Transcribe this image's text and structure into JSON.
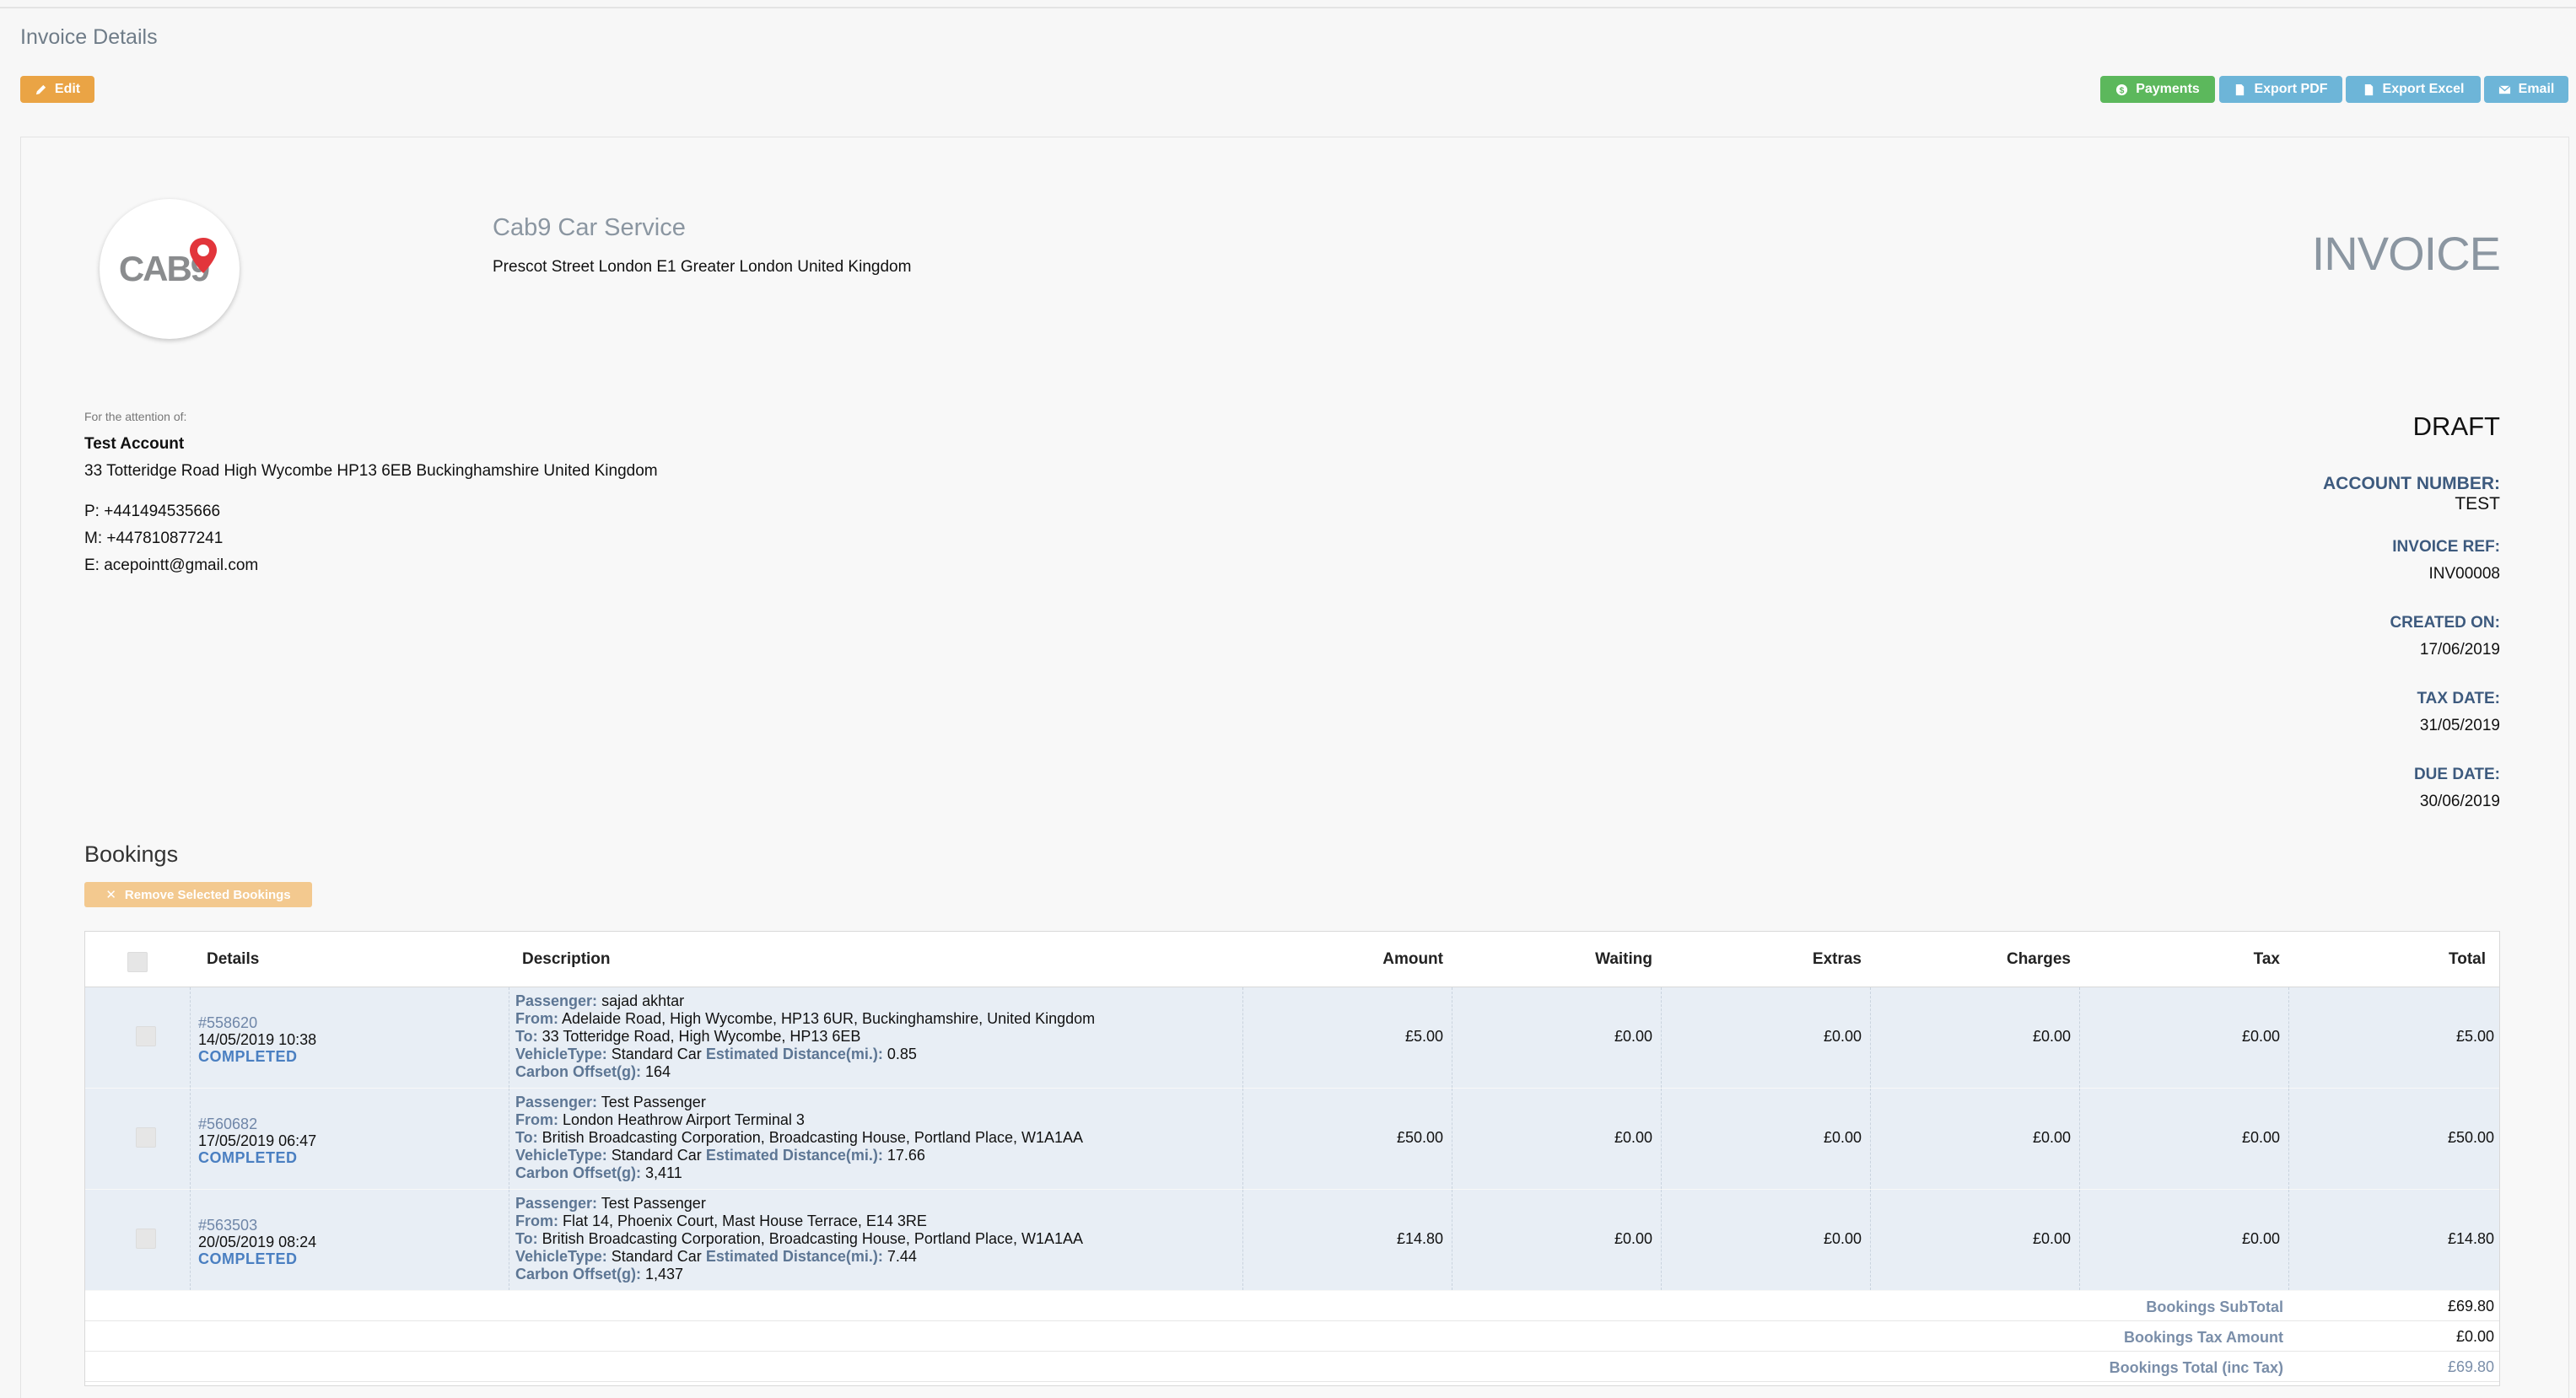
{
  "page": {
    "title": "Invoice Details"
  },
  "toolbar": {
    "edit_label": "Edit",
    "payments_label": "Payments",
    "export_pdf_label": "Export PDF",
    "export_excel_label": "Export Excel",
    "email_label": "Email"
  },
  "company": {
    "logo_text": "CAB9",
    "name": "Cab9 Car Service",
    "address": "Prescot Street London E1 Greater London United Kingdom"
  },
  "invoice": {
    "heading": "INVOICE",
    "status": "DRAFT",
    "account_number_label": "ACCOUNT NUMBER:",
    "account_number": "TEST",
    "invoice_ref_label": "INVOICE REF:",
    "invoice_ref": "INV00008",
    "created_on_label": "CREATED ON:",
    "created_on": "17/06/2019",
    "tax_date_label": "TAX DATE:",
    "tax_date": "31/05/2019",
    "due_date_label": "DUE DATE:",
    "due_date": "30/06/2019"
  },
  "recipient": {
    "attention_label": "For the attention of:",
    "name": "Test Account",
    "address": "33 Totteridge Road High Wycombe HP13 6EB Buckinghamshire United Kingdom",
    "phone": "P: +441494535666",
    "mobile": "M: +447810877241",
    "email": "E: acepointt@gmail.com"
  },
  "bookings": {
    "title": "Bookings",
    "remove_label": "Remove Selected Bookings",
    "columns": {
      "details": "Details",
      "description": "Description",
      "amount": "Amount",
      "waiting": "Waiting",
      "extras": "Extras",
      "charges": "Charges",
      "tax": "Tax",
      "total": "Total"
    },
    "field_labels": {
      "passenger": "Passenger:",
      "from": "From:",
      "to": "To:",
      "vehicle_type": "VehicleType:",
      "distance": "Estimated Distance(mi.):",
      "carbon": "Carbon Offset(g):"
    },
    "rows": [
      {
        "ref": "#558620",
        "datetime": "14/05/2019 10:38",
        "status": "COMPLETED",
        "passenger": "sajad akhtar",
        "from": "Adelaide Road, High Wycombe, HP13 6UR, Buckinghamshire, United Kingdom",
        "to": "33 Totteridge Road, High Wycombe, HP13 6EB",
        "vehicle": "Standard Car",
        "distance": "0.85",
        "carbon": "164",
        "amount": "£5.00",
        "waiting": "£0.00",
        "extras": "£0.00",
        "charges": "£0.00",
        "tax": "£0.00",
        "total": "£5.00"
      },
      {
        "ref": "#560682",
        "datetime": "17/05/2019 06:47",
        "status": "COMPLETED",
        "passenger": "Test Passenger",
        "from": "London Heathrow Airport Terminal 3",
        "to": "British Broadcasting Corporation, Broadcasting House, Portland Place, W1A1AA",
        "vehicle": "Standard Car",
        "distance": "17.66",
        "carbon": "3,411",
        "amount": "£50.00",
        "waiting": "£0.00",
        "extras": "£0.00",
        "charges": "£0.00",
        "tax": "£0.00",
        "total": "£50.00"
      },
      {
        "ref": "#563503",
        "datetime": "20/05/2019 08:24",
        "status": "COMPLETED",
        "passenger": "Test Passenger",
        "from": "Flat 14, Phoenix Court, Mast House Terrace, E14 3RE",
        "to": "British Broadcasting Corporation, Broadcasting House, Portland Place, W1A1AA",
        "vehicle": "Standard Car",
        "distance": "7.44",
        "carbon": "1,437",
        "amount": "£14.80",
        "waiting": "£0.00",
        "extras": "£0.00",
        "charges": "£0.00",
        "tax": "£0.00",
        "total": "£14.80"
      }
    ],
    "subtotal_label": "Bookings SubTotal",
    "subtotal": "£69.80",
    "tax_label": "Bookings Tax Amount",
    "tax_amount": "£0.00",
    "grand_label": "Bookings Total (inc Tax)",
    "grand_total": "£69.80"
  },
  "colors": {
    "edit": "#eaa445",
    "payments": "#5cb85c",
    "export": "#6db5d8",
    "remove": "#f3c98f",
    "status_completed": "#4a7fc1",
    "logo_pin": "#e2353b"
  }
}
